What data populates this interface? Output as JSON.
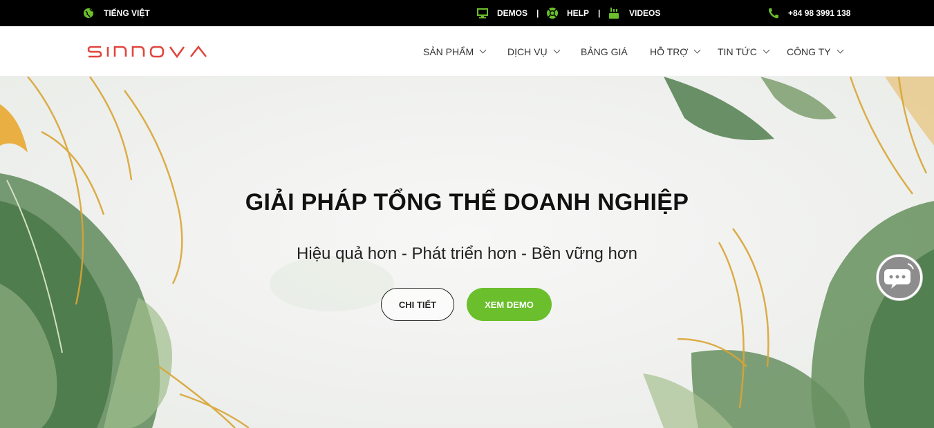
{
  "topbar": {
    "language": "TIẾNG VIỆT",
    "demos": "DEMOS",
    "help": "HELP",
    "videos": "VIDEOS",
    "separator": "|",
    "phone": "+84 98 3991 138",
    "icons": [
      "globe-icon",
      "monitor-icon",
      "lifebuoy-icon",
      "youtube-icon",
      "phone-icon"
    ],
    "icon_color": "#6cbf2c"
  },
  "header": {
    "logo": "SINNOVA",
    "logo_color": "#e0453d",
    "nav": [
      {
        "label": "SẢN PHẨM",
        "dropdown": true
      },
      {
        "label": "DỊCH VỤ",
        "dropdown": true
      },
      {
        "label": "BẢNG GIÁ",
        "dropdown": false
      },
      {
        "label": "HỖ TRỢ",
        "dropdown": true
      },
      {
        "label": "TIN TỨC",
        "dropdown": true
      },
      {
        "label": "CÔNG TY",
        "dropdown": true
      }
    ]
  },
  "hero": {
    "title": "GIẢI PHÁP TỔNG THỂ DOANH NGHIỆP",
    "subtitle": "Hiệu quả hơn - Phát triển hơn - Bền vững hơn",
    "detail_button": "CHI TIẾT",
    "demo_button": "XEM DEMO",
    "accent_color": "#6cbf2c"
  }
}
